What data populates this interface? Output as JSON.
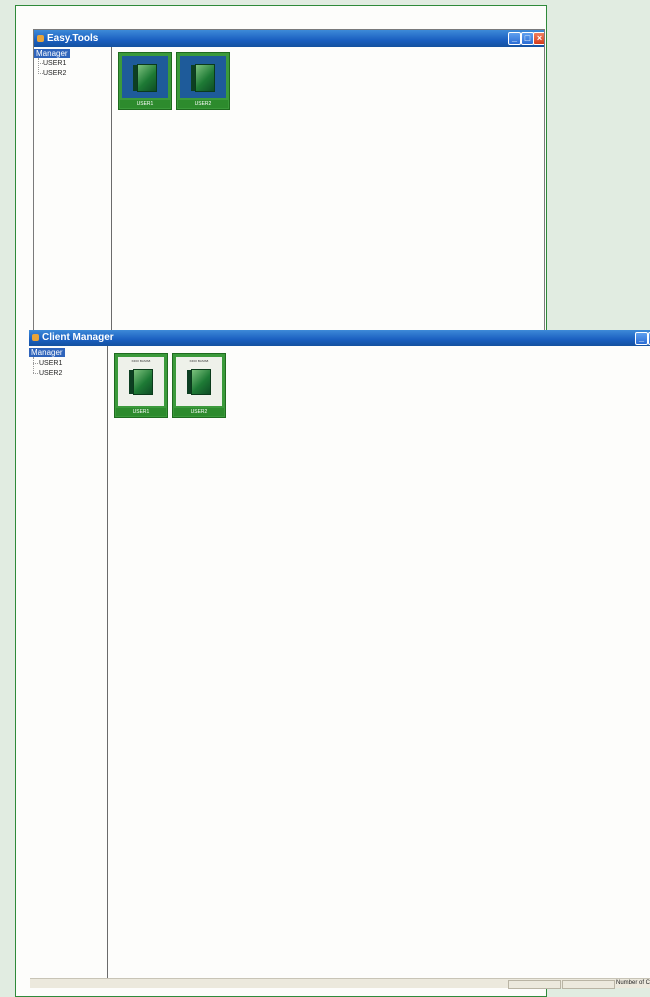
{
  "window_back": {
    "title": "Easy.Tools",
    "tree_root": "Manager",
    "tree_items": [
      "USER1",
      "USER2"
    ],
    "tiles": [
      {
        "label": "USER1"
      },
      {
        "label": "USER2"
      }
    ]
  },
  "window_front": {
    "title": "Client Manager",
    "tree_root": "Manager",
    "tree_items": [
      "USER1",
      "USER2"
    ],
    "tiles": [
      {
        "label": "USER1",
        "heading": "KIDO BASIS8"
      },
      {
        "label": "USER2",
        "heading": "KIDO BASIS8"
      }
    ]
  },
  "status_bar": {
    "text": "Number of Co"
  },
  "colors": {
    "titlebar": "#1a5fc0",
    "tile_green": "#3b9a3b",
    "tree_selection": "#2f64bb",
    "page_frame": "#2f8a3a"
  }
}
